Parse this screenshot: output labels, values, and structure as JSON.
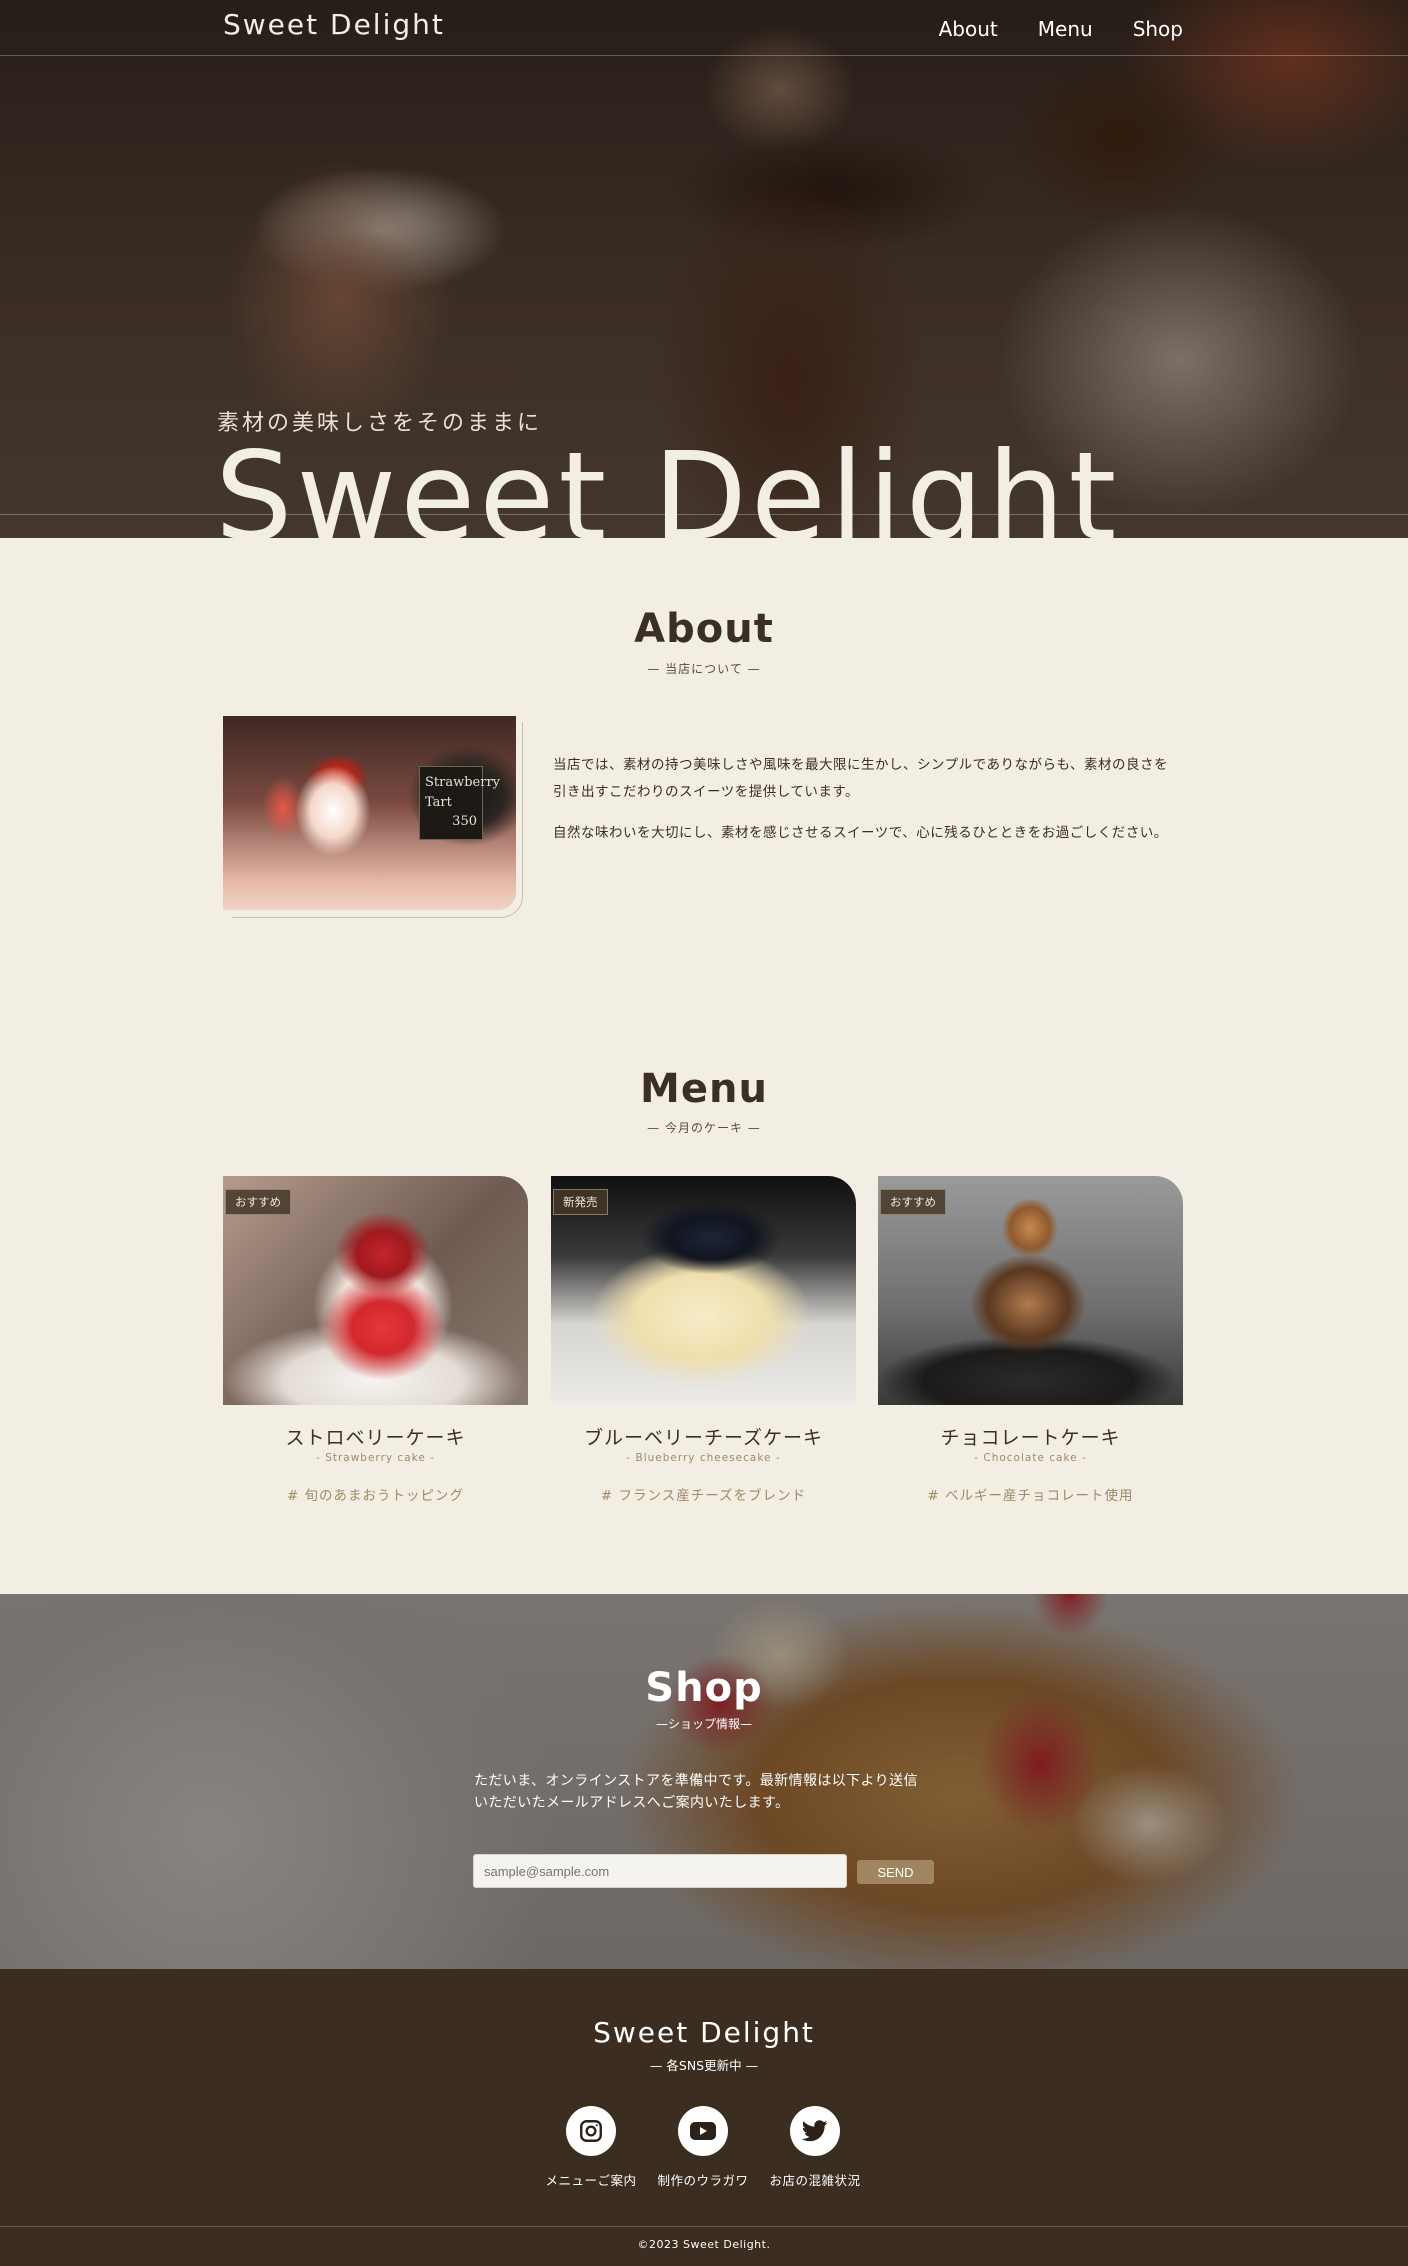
{
  "header": {
    "logo": "Sweet Delight",
    "nav": [
      "About",
      "Menu",
      "Shop"
    ]
  },
  "hero": {
    "subtitle": "素材の美味しさをそのままに",
    "title": "Sweet Delight"
  },
  "about": {
    "title": "About",
    "subtitle": "— 当店について —",
    "sign_text": "Strawberry Tart",
    "sign_price": "350",
    "paragraphs": [
      "当店では、素材の持つ美味しさや風味を最大限に生かし、シンプルでありながらも、素材の良さを引き出すこだわりのスイーツを提供しています。",
      "自然な味わいを大切にし、素材を感じさせるスイーツで、心に残るひとときをお過ごしください。"
    ]
  },
  "menu": {
    "title": "Menu",
    "subtitle": "— 今月のケーキ —",
    "items": [
      {
        "badge": "おすすめ",
        "name": "ストロベリーケーキ",
        "en": "- Strawberry cake -",
        "tag": "# 旬のあまおうトッピング"
      },
      {
        "badge": "新発売",
        "name": "ブルーベリーチーズケーキ",
        "en": "- Blueberry cheesecake -",
        "tag": "# フランス産チーズをブレンド"
      },
      {
        "badge": "おすすめ",
        "name": "チョコレートケーキ",
        "en": "- Chocolate cake -",
        "tag": "# ベルギー産チョコレート使用"
      }
    ]
  },
  "shop": {
    "title": "Shop",
    "subtitle": "—ショップ情報—",
    "text_line1": "ただいま、オンラインストアを準備中です。最新情報は以下より送信",
    "text_line2": "いただいたメールアドレスへご案内いたします。",
    "email_placeholder": "sample@sample.com",
    "send_label": "SEND"
  },
  "footer": {
    "logo": "Sweet Delight",
    "subtitle": "— 各SNS更新中 —",
    "sns": [
      {
        "icon": "instagram-icon",
        "label": "メニューご案内"
      },
      {
        "icon": "youtube-icon",
        "label": "制作のウラガワ"
      },
      {
        "icon": "twitter-icon",
        "label": "お店の混雑状況"
      }
    ],
    "copyright": "©2023 Sweet Delight."
  }
}
